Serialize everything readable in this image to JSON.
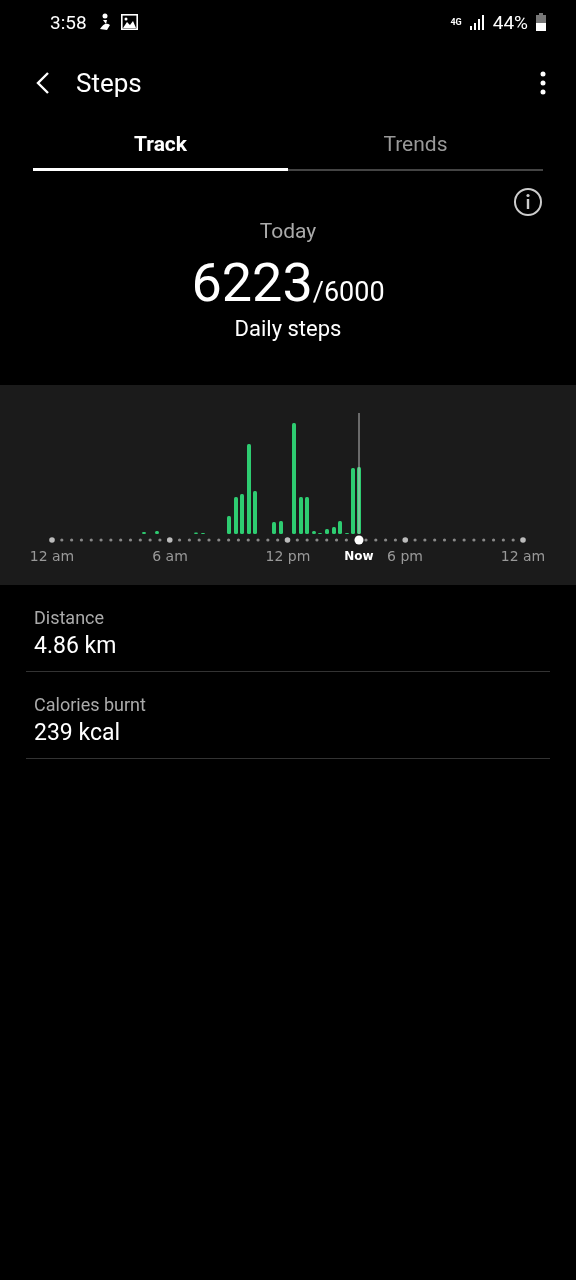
{
  "status_bar": {
    "time": "3:58",
    "network": "4G",
    "battery": "44%"
  },
  "header": {
    "title": "Steps"
  },
  "tabs": [
    {
      "label": "Track",
      "selected": true
    },
    {
      "label": "Trends",
      "selected": false
    }
  ],
  "summary": {
    "period": "Today",
    "steps": "6223",
    "goal": "/6000",
    "caption": "Daily steps"
  },
  "chart": {
    "x_labels": [
      {
        "label": "12 am",
        "kind": "tick"
      },
      {
        "label": "6 am",
        "kind": "tick"
      },
      {
        "label": "12 pm",
        "kind": "tick"
      },
      {
        "label": "Now",
        "kind": "now"
      },
      {
        "label": "6 pm",
        "kind": "tick"
      },
      {
        "label": "12 am",
        "kind": "tick"
      }
    ]
  },
  "metrics": [
    {
      "label": "Distance",
      "value": "4.86 km"
    },
    {
      "label": "Calories burnt",
      "value": "239 kcal"
    }
  ]
}
